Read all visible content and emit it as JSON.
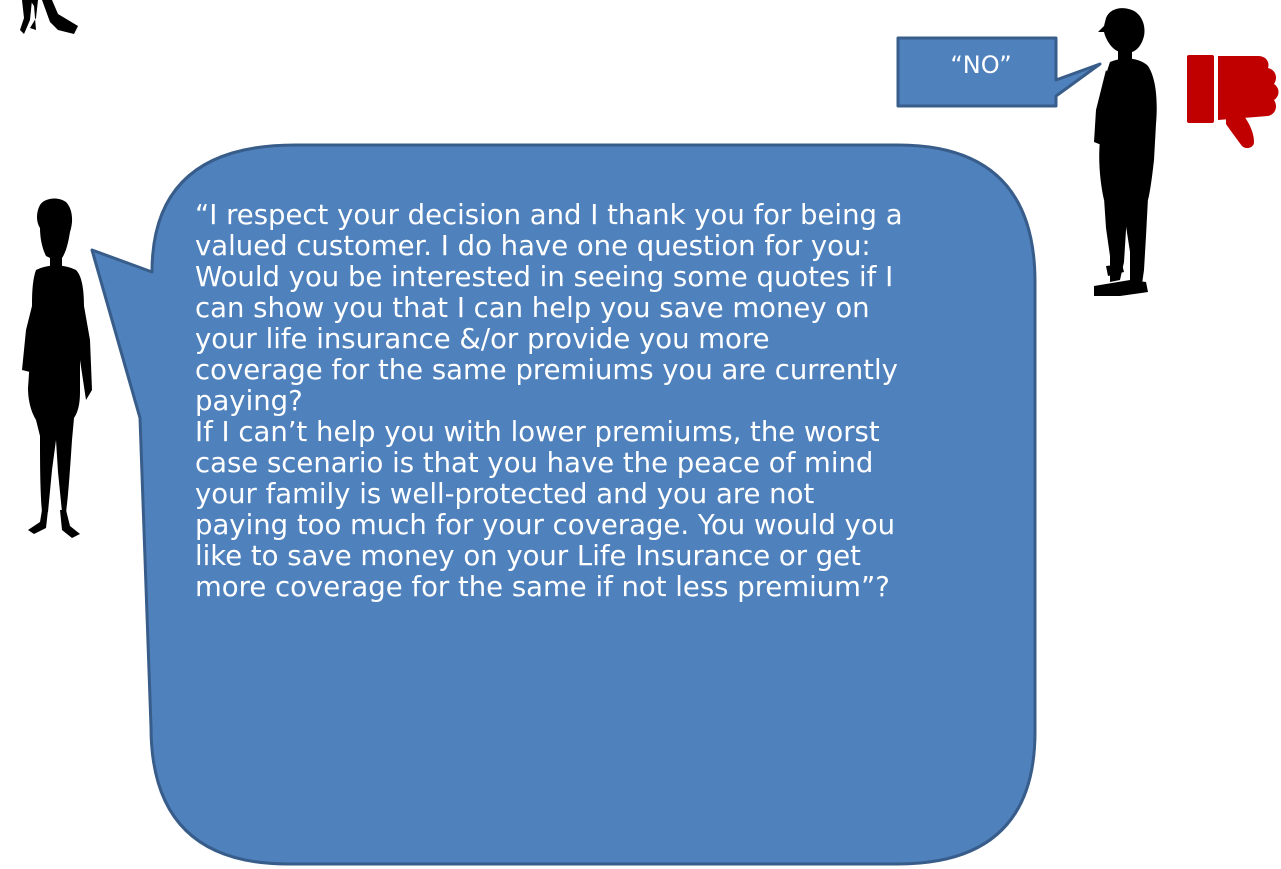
{
  "customer_reply": {
    "text": "“NO”"
  },
  "agent_speech": {
    "text": "“I respect your decision and I thank you for being a\nvalued customer. I do have one question for you:\nWould you be interested in seeing some quotes if I\ncan show you that I can help you save money on\nyour life insurance &/or provide you more\ncoverage for the same premiums you are currently\npaying?\nIf I can’t help you with lower premiums, the worst\ncase scenario is that you have the peace of mind\nyour family is well-protected and you are not\npaying too much for your coverage. You would you\nlike to save money on your Life Insurance or get\nmore coverage for the same if not less premium”?"
  },
  "icons": {
    "reaction": "thumbs-down-icon",
    "agent": "woman-silhouette-icon",
    "customer": "man-silhouette-icon"
  },
  "colors": {
    "bubble_fill": "#4F81BD",
    "bubble_stroke": "#385D8A",
    "text": "#FFFFFF",
    "thumbs_down": "#C00000",
    "silhouette": "#000000"
  }
}
